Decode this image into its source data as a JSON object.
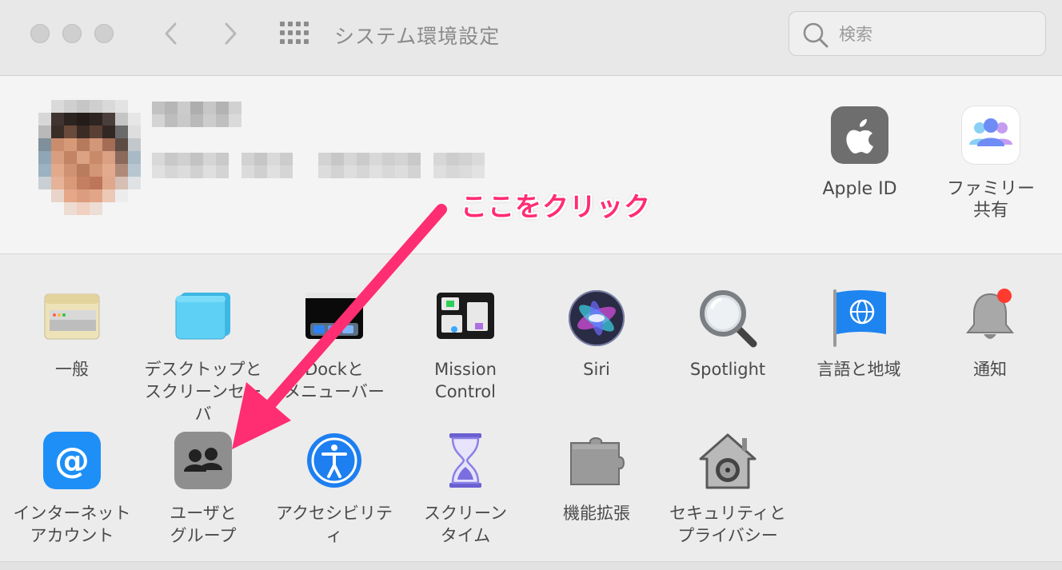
{
  "window": {
    "title": "システム環境設定"
  },
  "search": {
    "placeholder": "検索"
  },
  "account": {
    "items": [
      {
        "label": "Apple ID",
        "icon": "apple-logo-icon"
      },
      {
        "label": "ファミリー\n共有",
        "icon": "family-sharing-icon"
      }
    ]
  },
  "prefs": {
    "row1": [
      {
        "label": "一般",
        "icon": "general-icon"
      },
      {
        "label": "デスクトップと\nスクリーンセーバ",
        "icon": "desktop-screensaver-icon"
      },
      {
        "label": "Dockと\nメニューバー",
        "icon": "dock-menubar-icon"
      },
      {
        "label": "Mission\nControl",
        "icon": "mission-control-icon"
      },
      {
        "label": "Siri",
        "icon": "siri-icon"
      },
      {
        "label": "Spotlight",
        "icon": "spotlight-icon"
      },
      {
        "label": "言語と地域",
        "icon": "language-region-icon"
      },
      {
        "label": "通知",
        "icon": "notifications-icon"
      }
    ],
    "row2": [
      {
        "label": "インターネット\nアカウント",
        "icon": "internet-accounts-icon"
      },
      {
        "label": "ユーザと\nグループ",
        "icon": "users-groups-icon"
      },
      {
        "label": "アクセシビリティ",
        "icon": "accessibility-icon"
      },
      {
        "label": "スクリーン\nタイム",
        "icon": "screen-time-icon"
      },
      {
        "label": "機能拡張",
        "icon": "extensions-icon"
      },
      {
        "label": "セキュリティと\nプライバシー",
        "icon": "security-privacy-icon"
      }
    ]
  },
  "annotation": {
    "text": "ここをクリック",
    "color": "#ff2d72"
  }
}
